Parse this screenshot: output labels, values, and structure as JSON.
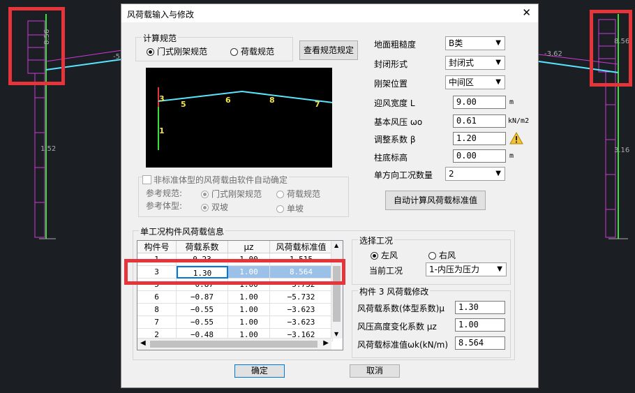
{
  "background": {
    "left_dims": {
      "upper": "8.56",
      "lower": "1.52",
      "beam": "-5"
    },
    "right_dims": {
      "upper": "8.56",
      "lower": "3.16",
      "beam": "-3.62"
    }
  },
  "dialog": {
    "title": "风荷载输入与修改",
    "close_label": "✕",
    "code_group": {
      "label": "计算规范",
      "options": [
        "门式刚架规范",
        "荷载规范"
      ],
      "selected": "门式刚架规范",
      "view_button": "查看规范规定"
    },
    "preview_labels": [
      "3",
      "5",
      "6",
      "8",
      "7",
      "4",
      "1",
      "2"
    ],
    "params": {
      "roughness_label": "地面粗糙度",
      "roughness_value": "B类",
      "closure_label": "封闭形式",
      "closure_value": "封闭式",
      "frame_pos_label": "刚架位置",
      "frame_pos_value": "中间区",
      "width_label": "迎风宽度 L",
      "width_value": "9.00",
      "width_unit": "m",
      "pressure_label": "基本风压 ωo",
      "pressure_value": "0.61",
      "pressure_unit": "kN/m2",
      "adjust_label": "调整系数 β",
      "adjust_value": "1.20",
      "base_label": "柱底标高",
      "base_value": "0.00",
      "base_unit": "m",
      "cases_label": "单方向工况数量",
      "cases_value": "2"
    },
    "auto_calc_button": "自动计算风荷载标准值",
    "nonstd": {
      "checkbox_label": "非标准体型的风荷载由软件自动确定",
      "ref_code_label": "参考规范:",
      "ref_code_options": [
        "门式刚架规范",
        "荷载规范"
      ],
      "ref_shape_label": "参考体型:",
      "ref_shape_options": [
        "双坡",
        "单坡"
      ]
    },
    "member_group": {
      "label": "单工况构件风荷载信息",
      "columns": [
        "构件号",
        "荷载系数",
        "μz",
        "风荷载标准值"
      ],
      "rows": [
        [
          "1",
          "0.23",
          "1.00",
          "1.515"
        ],
        [
          "3",
          "1.30",
          "1.00",
          "8.564"
        ],
        [
          "5",
          "−0.87",
          "1.00",
          "−5.732"
        ],
        [
          "6",
          "−0.87",
          "1.00",
          "−5.732"
        ],
        [
          "8",
          "−0.55",
          "1.00",
          "−3.623"
        ],
        [
          "7",
          "−0.55",
          "1.00",
          "−3.623"
        ],
        [
          "2",
          "−0.48",
          "1.00",
          "−3.162"
        ]
      ],
      "selected_row": 1
    },
    "case_group": {
      "label": "选择工况",
      "options": [
        "左风",
        "右风"
      ],
      "selected": "左风",
      "current_label": "当前工况",
      "current_value": "1-内压为压力"
    },
    "modify_group": {
      "label": "构件 3 风荷载修改",
      "coef_label": "风荷载系数(体型系数)μ",
      "coef_value": "1.30",
      "height_label": "风压高度变化系数 μz",
      "height_value": "1.00",
      "std_label": "风荷载标准值ωk(kN/m)",
      "std_value": "8.564"
    },
    "ok_button": "确定",
    "cancel_button": "取消"
  },
  "colors": {
    "highlight": "#e5343a",
    "selection": "#9cc1e8",
    "frame": "#59e5ff",
    "column": "#3adf3a",
    "load": "#d038d8"
  }
}
